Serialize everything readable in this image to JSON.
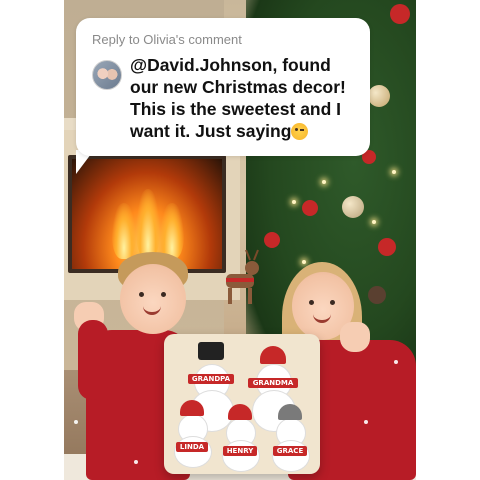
{
  "comment": {
    "reply_label": "Reply to Olivia's comment",
    "text": "@David.Johnson, found our new Christmas decor! This is the sweetest and I want it. Just saying",
    "emoji": "winking-face"
  },
  "pillow": {
    "signs": [
      "GRANDPA",
      "GRANDMA",
      "LINDA",
      "HENRY",
      "GRACE"
    ]
  },
  "colors": {
    "sweater": "#b71c26",
    "bubble_bg": "#ffffff",
    "reply_label": "#8a8a8a",
    "comment_text": "#111111"
  }
}
